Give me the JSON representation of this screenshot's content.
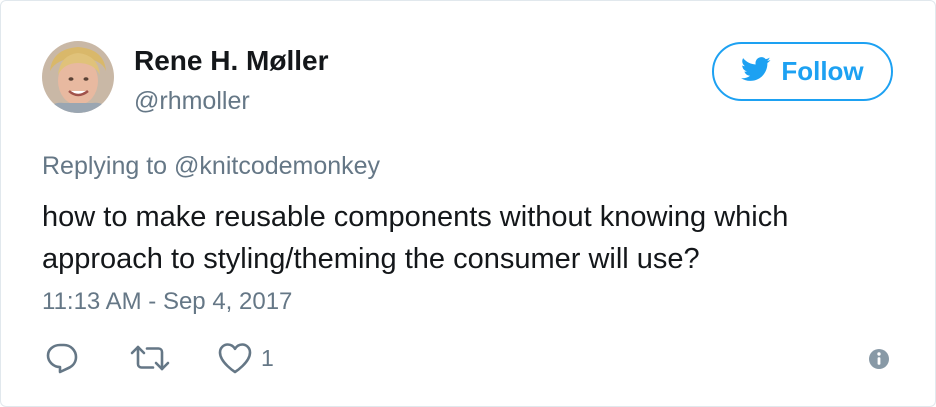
{
  "author": {
    "name": "Rene H. Møller",
    "handle": "@rhmoller",
    "avatar_icon": "user-avatar-photo"
  },
  "follow_button": {
    "label": "Follow",
    "icon": "twitter-bird-icon",
    "color": "#1da1f2"
  },
  "reply_context": {
    "prefix": "Replying to",
    "mention": "@knitcodemonkey"
  },
  "tweet": {
    "text": "how to make reusable components without knowing which approach to styling/theming the consumer will use?",
    "timestamp": "11:13 AM - Sep 4, 2017"
  },
  "actions": {
    "reply_icon": "reply-icon",
    "retweet_icon": "retweet-icon",
    "like_icon": "heart-icon",
    "like_count": "1",
    "info_icon": "info-icon"
  },
  "colors": {
    "text_primary": "#14171a",
    "text_secondary": "#657786",
    "border": "#e1e8ed"
  }
}
